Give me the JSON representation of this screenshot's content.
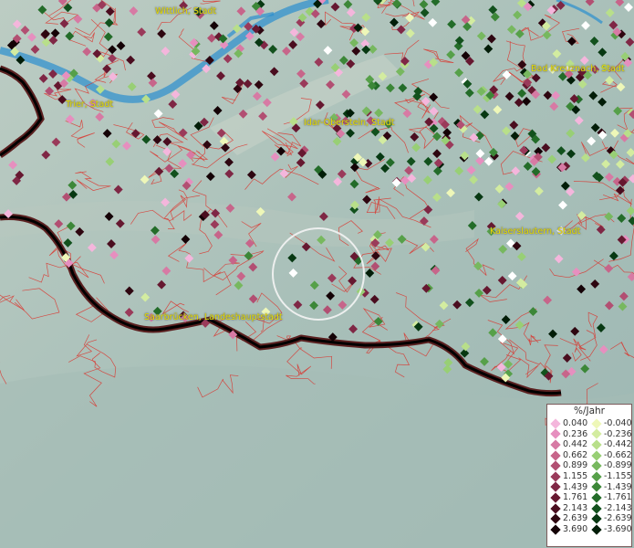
{
  "map": {
    "cities": [
      {
        "name": "Wittlich, Stadt"
      },
      {
        "name": "Bad Kreuznach, Stadt"
      },
      {
        "name": "Trier, Stadt"
      },
      {
        "name": "Idar-Oberstein, Stadt"
      },
      {
        "name": "Kaiserslautern, Stadt"
      },
      {
        "name": "Saarbrücken, Landeshauptstadt"
      }
    ]
  },
  "legend": {
    "title": "%/Jahr",
    "positive": [
      {
        "value": "0.040",
        "color": "#f4b6dc"
      },
      {
        "value": "0.236",
        "color": "#e68fbf"
      },
      {
        "value": "0.442",
        "color": "#d77aa4"
      },
      {
        "value": "0.662",
        "color": "#c7658a"
      },
      {
        "value": "0.899",
        "color": "#b24f72"
      },
      {
        "value": "1.155",
        "color": "#9a3a5a"
      },
      {
        "value": "1.439",
        "color": "#7f2745"
      },
      {
        "value": "1.761",
        "color": "#661830"
      },
      {
        "value": "2.143",
        "color": "#4a0d1f"
      },
      {
        "value": "2.639",
        "color": "#2e0610"
      },
      {
        "value": "3.690",
        "color": "#140206"
      }
    ],
    "negative": [
      {
        "value": "-0.040",
        "color": "#eef7b8"
      },
      {
        "value": "-0.236",
        "color": "#d3eca0"
      },
      {
        "value": "-0.442",
        "color": "#b8df8a"
      },
      {
        "value": "-0.662",
        "color": "#98cf75"
      },
      {
        "value": "-0.899",
        "color": "#77b85f"
      },
      {
        "value": "-1.155",
        "color": "#56a049"
      },
      {
        "value": "-1.439",
        "color": "#3c8738"
      },
      {
        "value": "-1.761",
        "color": "#236c29"
      },
      {
        "value": "-2.143",
        "color": "#12511d"
      },
      {
        "value": "-2.639",
        "color": "#073812"
      },
      {
        "value": "-3.690",
        "color": "#021d08"
      }
    ]
  }
}
